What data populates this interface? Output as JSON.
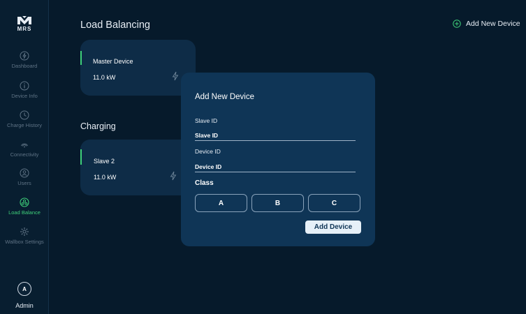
{
  "brand": {
    "logo_text": "MRS"
  },
  "sidebar": {
    "items": [
      {
        "label": "Dashboard",
        "icon": "dashboard-icon",
        "active": false
      },
      {
        "label": "Device Info",
        "icon": "info-icon",
        "active": false
      },
      {
        "label": "Charge History",
        "icon": "clock-icon",
        "active": false
      },
      {
        "label": "Connectivity",
        "icon": "wifi-icon",
        "active": false
      },
      {
        "label": "Users",
        "icon": "user-icon",
        "active": false
      },
      {
        "label": "Load Balance",
        "icon": "load-balance-icon",
        "active": true
      },
      {
        "label": "Wallbox Settings",
        "icon": "gear-icon",
        "active": false
      }
    ],
    "admin": {
      "avatar_letter": "A",
      "label": "Admin"
    }
  },
  "header": {
    "title": "Load Balancing",
    "add_new_label": "Add New Device"
  },
  "master": {
    "name": "Master Device",
    "power": "11.0 kW"
  },
  "charging": {
    "section_title": "Charging",
    "device": {
      "name": "Slave 2",
      "power": "11.0 kW"
    }
  },
  "modal": {
    "title": "Add New Device",
    "slave_id": {
      "label": "Slave ID",
      "placeholder": "Slave ID"
    },
    "device_id": {
      "label": "Device ID",
      "placeholder": "Device ID"
    },
    "class_label": "Class",
    "class_options": [
      "A",
      "B",
      "C"
    ],
    "submit_label": "Add Device"
  },
  "colors": {
    "background": "#061a2b",
    "card": "#0e2c47",
    "modal": "#0f3556",
    "accent": "#3fd07a"
  }
}
